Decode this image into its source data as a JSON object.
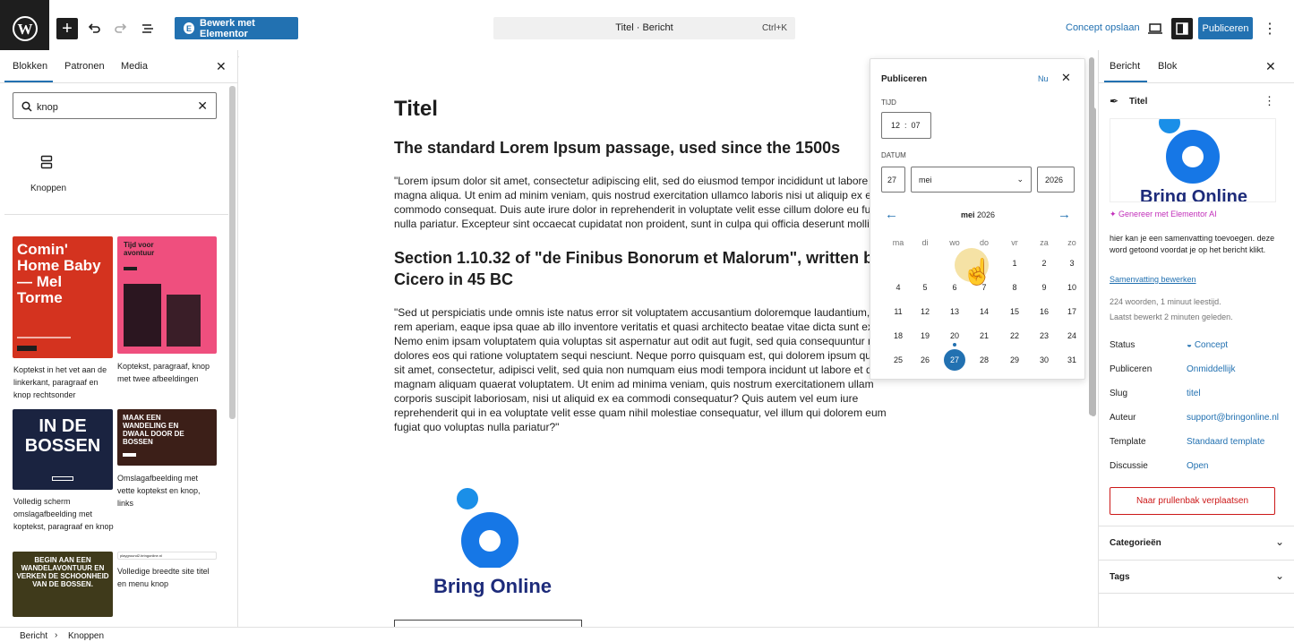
{
  "topbar": {
    "elementor_label": "Bewerk met Elementor",
    "command_title": "Titel · Bericht",
    "command_shortcut": "Ctrl+K",
    "save_draft": "Concept opslaan",
    "publish": "Publiceren"
  },
  "left": {
    "tabs": [
      "Blokken",
      "Patronen",
      "Media"
    ],
    "search_value": "knop",
    "block_label": "Knoppen",
    "patterns": [
      {
        "caption": "Koptekst in het vet aan de linkerkant, paragraaf en knop rechtsonder",
        "image_text": "Comin' Home Baby — Mel Torme",
        "color": "#d4331f"
      },
      {
        "caption": "Koptekst, paragraaf, knop met twee afbeeldingen",
        "image_text": "Tijd voor avontuur",
        "color": "#ef4f7e"
      },
      {
        "caption": "Volledig scherm omslagafbeelding met koptekst, paragraaf en knop",
        "image_text": "IN DE BOSSEN",
        "color": "#1a2340"
      },
      {
        "caption": "Omslagafbeelding met vette koptekst en knop, links",
        "image_text": "MAAK EEN WANDELING EN DWAAL DOOR DE BOSSEN",
        "color": "#3c1f18"
      },
      {
        "caption": "",
        "image_text": "BEGIN AAN EEN WANDELAVONTUUR EN VERKEN DE SCHOONHEID VAN DE BOSSEN.",
        "color": "#3f3a1b"
      },
      {
        "caption": "Volledige breedte site titel en menu knop",
        "image_text": "playground2.bringonline.nl",
        "color": "#ffffff"
      }
    ]
  },
  "document": {
    "title": "Titel",
    "h1": "The standard Lorem Ipsum passage, used since the 1500s",
    "p1": "\"Lorem ipsum dolor sit amet, consectetur adipiscing elit, sed do eiusmod tempor incididunt ut labore et dolore magna aliqua. Ut enim ad minim veniam, quis nostrud exercitation ullamco laboris nisi ut aliquip ex ea commodo consequat. Duis aute irure dolor in reprehenderit in voluptate velit esse cillum dolore eu fugiat nulla pariatur. Excepteur sint occaecat cupidatat non proident, sunt in culpa qui officia deserunt mollit anim id est laborum.\"",
    "h2": "Section 1.10.32 of \"de Finibus Bonorum et Malorum\", written by Cicero in 45 BC",
    "p2": "\"Sed ut perspiciatis unde omnis iste natus error sit voluptatem accusantium doloremque laudantium, totam rem aperiam, eaque ipsa quae ab illo inventore veritatis et quasi architecto beatae vitae dicta sunt explicabo. Nemo enim ipsam voluptatem quia voluptas sit aspernatur aut odit aut fugit, sed quia consequuntur magni dolores eos qui ratione voluptatem sequi nesciunt. Neque porro quisquam est, qui dolorem ipsum quia dolor sit amet, consectetur, adipisci velit, sed quia non numquam eius modi tempora incidunt ut labore et dolore magnam aliquam quaerat voluptatem. Ut enim ad minima veniam, quis nostrum exercitationem ullam corporis suscipit laboriosam, nisi ut aliquid ex ea commodi consequatur? Quis autem vel eum iure reprehenderit qui in ea voluptate velit esse quam nihil molestiae consequatur, vel illum qui dolorem eum fugiat quo voluptas nulla pariatur?\"",
    "logo_text": "Bring Online"
  },
  "popover": {
    "title": "Publiceren",
    "now": "Nu",
    "time_label": "TIJD",
    "hour": "12",
    "minute": "07",
    "date_label": "DATUM",
    "day": "27",
    "month": "mei",
    "year": "2026",
    "month_year_bold": "mei",
    "month_year_rest": " 2026",
    "weekdays": [
      "ma",
      "di",
      "wo",
      "do",
      "vr",
      "za",
      "zo"
    ],
    "weeks": [
      [
        "",
        "",
        "",
        "",
        "1",
        "2",
        "3"
      ],
      [
        "4",
        "5",
        "6",
        "7",
        "8",
        "9",
        "10"
      ],
      [
        "11",
        "12",
        "13",
        "14",
        "15",
        "16",
        "17"
      ],
      [
        "18",
        "19",
        "20",
        "21",
        "22",
        "23",
        "24"
      ],
      [
        "25",
        "26",
        "27",
        "28",
        "29",
        "30",
        "31"
      ]
    ],
    "selected_day": "27",
    "today": "20",
    "accent": "#2271b1"
  },
  "right": {
    "tabs": [
      "Bericht",
      "Blok"
    ],
    "post_title": "Titel",
    "logo_text": "Bring Online",
    "ai_link": "Genereer met Elementor AI",
    "excerpt": "hier kan je een samenvatting toevoegen. deze word getoond voordat je op het bericht klikt.",
    "excerpt_link": "Samenvatting bewerken",
    "meta1": "224 woorden, 1 minuut leestijd.",
    "meta2": "Laatst bewerkt 2 minuten geleden.",
    "rows": [
      {
        "label": "Status",
        "value": "Concept"
      },
      {
        "label": "Publiceren",
        "value": "Onmiddellijk"
      },
      {
        "label": "Slug",
        "value": "titel"
      },
      {
        "label": "Auteur",
        "value": "support@bringonline.nl"
      },
      {
        "label": "Template",
        "value": "Standaard template"
      },
      {
        "label": "Discussie",
        "value": "Open"
      }
    ],
    "trash": "Naar prullenbak verplaatsen",
    "sections": [
      "Categorieën",
      "Tags"
    ]
  },
  "footer": {
    "crumb1": "Bericht",
    "crumb2": "Knoppen"
  }
}
